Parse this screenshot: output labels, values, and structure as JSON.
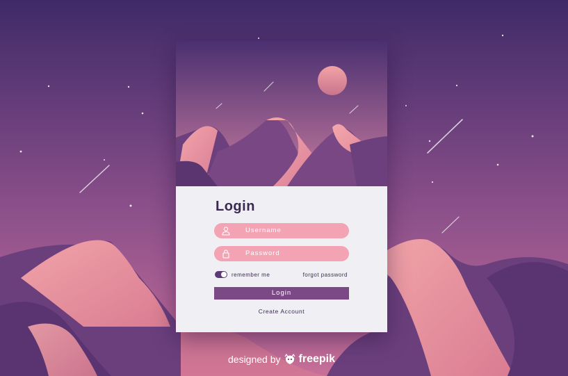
{
  "login": {
    "title": "Login",
    "username_placeholder": "Username",
    "password_placeholder": "Password",
    "remember_label": "remember me",
    "remember_checked": true,
    "forgot_label": "forgot password",
    "submit_label": "Login",
    "create_label": "Create Account"
  },
  "credit": {
    "prefix": "designed by",
    "brand": "freepik"
  },
  "colors": {
    "accent": "#7b4a86",
    "field": "#f3a3b4",
    "panel": "#f0eff3",
    "sky_top": "#3f2a68",
    "sky_bottom": "#c66f98"
  },
  "icons": {
    "username": "user-icon",
    "password": "lock-icon",
    "brand": "freepik-logo-icon"
  }
}
